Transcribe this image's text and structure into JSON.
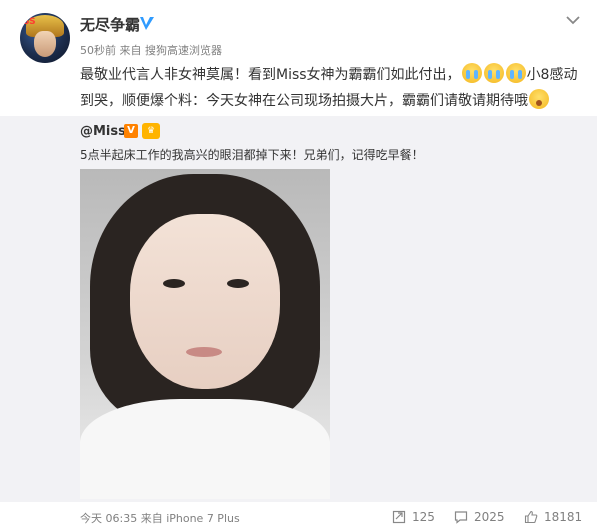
{
  "post": {
    "user_name": "无尽争霸",
    "meta": "50秒前 来自 搜狗高速浏览器",
    "text_part1": "最敬业代言人非女神莫属！看到Miss女神为霸霸们如此付出，",
    "text_part2": "小8感动到哭，顺便爆个料：今天女神在公司现场拍摄大片，霸霸们请敬请期待哦",
    "avatar_badge": "SS"
  },
  "repost": {
    "author": "@Miss",
    "vbadge": "V",
    "text": "5点半起床工作的我高兴的眼泪都掉下来！兄弟们，记得吃早餐！"
  },
  "footer": {
    "time": "今天 06:35 来自 iPhone 7 Plus",
    "repost_count": "125",
    "comment_count": "2025",
    "like_count": "18181"
  },
  "colors": {
    "accent_orange": "#ff8200",
    "verified_blue": "#2f9bff",
    "repost_bg": "#f2f2f5",
    "meta_gray": "#808080"
  },
  "icons": [
    "verified-icon",
    "chevron-down-icon",
    "repost-icon",
    "comment-icon",
    "like-icon"
  ]
}
